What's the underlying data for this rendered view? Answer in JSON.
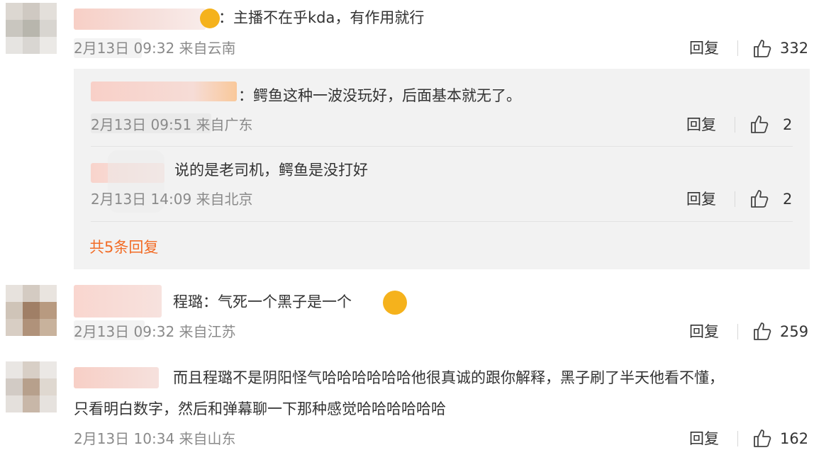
{
  "comments": [
    {
      "text": "：主播不在乎kda，有作用就行",
      "meta": "2月13日 09:32 来自云南",
      "reply_label": "回复",
      "likes": "332",
      "emoji": "hands-emoji"
    },
    {
      "text": "程璐：气死一个黑子是一个",
      "meta": "2月13日 09:32 来自江苏",
      "reply_label": "回复",
      "likes": "259",
      "emoji": "crying-laughing-emoji"
    },
    {
      "text_line1": "而且程璐不是阴阳怪气哈哈哈哈哈哈他很真诚的跟你解释，黑子刷了半天他看不懂，",
      "text_line2": "只看明白数字，然后和弹幕聊一下那种感觉哈哈哈哈哈哈",
      "meta": "2月13日 10:34 来自山东",
      "reply_label": "回复",
      "likes": "162"
    }
  ],
  "replies": [
    {
      "text": "：鳄鱼这种一波没玩好，后面基本就无了。",
      "meta": "2月13日 09:51 来自广东",
      "reply_label": "回复",
      "likes": "2"
    },
    {
      "text": "说的是老司机，鳄鱼是没打好",
      "meta": "2月13日 14:09 来自北京",
      "reply_label": "回复",
      "likes": "2"
    }
  ],
  "more_replies": "共5条回复",
  "colors": {
    "accent_orange": "#f26c26",
    "panel_bg": "#f2f2f2",
    "meta_gray": "#8a8a8a"
  },
  "icons": {
    "like": "thumbs-up-icon"
  }
}
